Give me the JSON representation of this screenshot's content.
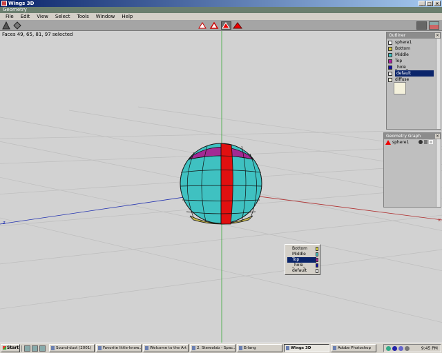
{
  "window": {
    "title": "Wings 3D"
  },
  "geometry_bar": {
    "label": "Geometry"
  },
  "menu": [
    "File",
    "Edit",
    "View",
    "Select",
    "Tools",
    "Window",
    "Help"
  ],
  "status": {
    "text": "Faces 49, 65, 81, 97 selected"
  },
  "viewport": {
    "axis_labels": {
      "x": "x",
      "z": "z"
    },
    "colors": {
      "bottom": "#c8b84a",
      "middle": "#3fc1c1",
      "top": "#a32a94",
      "selected": "#e01010",
      "grid_bg": "#d2d2d2"
    }
  },
  "outliner": {
    "title": "Outliner",
    "items": [
      {
        "label": "sphere1",
        "color": "#ffffff",
        "icon": "object-icon"
      },
      {
        "label": "Bottom",
        "color": "#d8c840",
        "icon": "material-icon"
      },
      {
        "label": "Middle",
        "color": "#3fc1c1",
        "icon": "material-icon"
      },
      {
        "label": "Top",
        "color": "#b020a0",
        "icon": "material-icon"
      },
      {
        "label": "_hole_",
        "color": "#1010a0",
        "icon": "material-icon"
      },
      {
        "label": "default",
        "color": "#e8e8e8",
        "icon": "material-icon"
      },
      {
        "label": "diffuse",
        "color": "#f4f1dc",
        "icon": "image-icon"
      }
    ],
    "selected": "default"
  },
  "geometry_graph": {
    "title": "Geometry Graph",
    "items": [
      {
        "label": "sphere1"
      }
    ]
  },
  "material_popup": {
    "items": [
      {
        "label": "Bottom",
        "color": "#e8e040"
      },
      {
        "label": "Middle",
        "color": "#3fc1c1"
      },
      {
        "label": "Top",
        "color": "#b020a0"
      },
      {
        "label": "_hole_",
        "color": "#1010a0"
      },
      {
        "label": "default",
        "color": "#f4f4f4"
      }
    ],
    "selected": "Top"
  },
  "taskbar": {
    "start_label": "Start",
    "buttons": [
      {
        "label": "Sound-dust (2001)",
        "active": false
      },
      {
        "label": "Favorite little-know...",
        "active": false
      },
      {
        "label": "Welcome to the Art ...",
        "active": false
      },
      {
        "label": "2. Stereolab - Spac...",
        "active": false
      },
      {
        "label": "Erlang",
        "active": false
      },
      {
        "label": "Wings 3D",
        "active": true
      },
      {
        "label": "Adobe Photoshop",
        "active": false
      }
    ],
    "clock": "9:45 PM"
  }
}
